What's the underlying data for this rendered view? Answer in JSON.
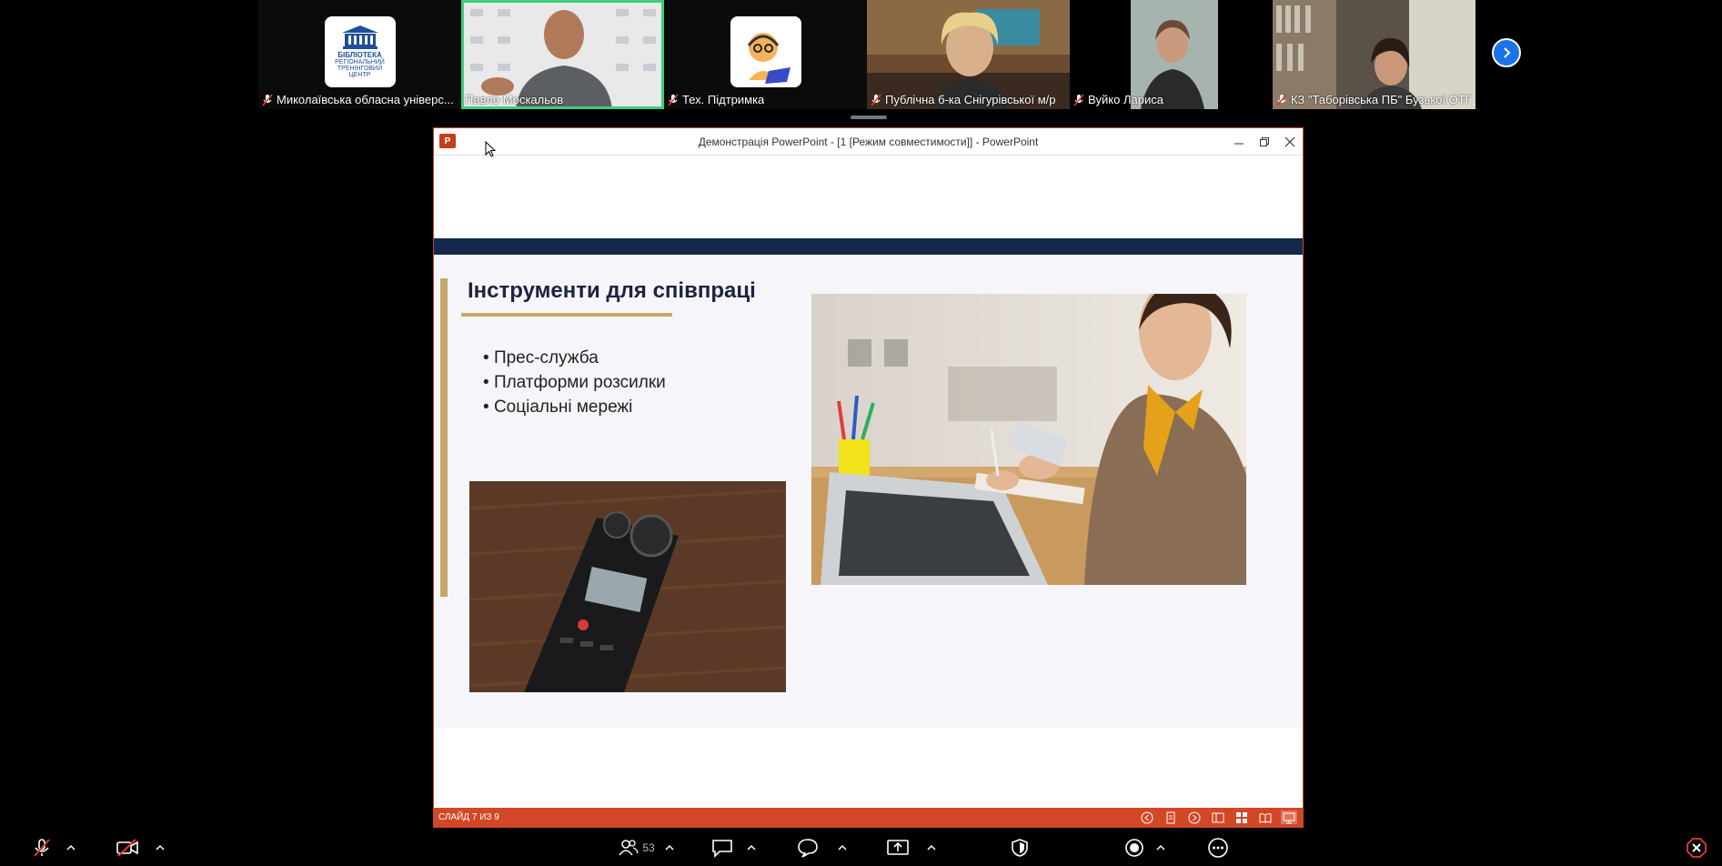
{
  "participants": [
    {
      "name": "Миколаївська обласна універс...",
      "muted": true,
      "type": "logo",
      "logo_lines": [
        "БІБЛІОТЕКА",
        "РЕГІОНАЛЬНИЙ",
        "ТРЕНІНГОВИЙ",
        "ЦЕНТР"
      ]
    },
    {
      "name": "Павло Москальов",
      "muted": false,
      "type": "video",
      "active": true
    },
    {
      "name": "Тех. Підтримка",
      "muted": true,
      "type": "avatar"
    },
    {
      "name": "Публічна б-ка Снігурівської м/р",
      "muted": true,
      "type": "video"
    },
    {
      "name": "Вуйко Лариса",
      "muted": true,
      "type": "video"
    },
    {
      "name": "КЗ \"Таборівська ПБ\" Бузької ОТГ",
      "muted": true,
      "type": "video"
    }
  ],
  "ppt": {
    "window_title": "Демонстрація PowerPoint - [1 [Режим совместимости]] - PowerPoint",
    "logo": "P",
    "slide": {
      "title": "Інструменти для співпраці",
      "bullets": [
        "Прес-служба",
        "Платформи розсилки",
        "Соціальні мережі"
      ]
    },
    "status_text": "СЛАЙД 7 ИЗ 9"
  },
  "toolbar": {
    "participants_count": "53"
  },
  "colors": {
    "accent_green": "#3ccf7a",
    "ppt_orange": "#d24726",
    "slide_navy": "#14284b",
    "slide_gold": "#c3a86a",
    "close_red": "#e53935"
  }
}
